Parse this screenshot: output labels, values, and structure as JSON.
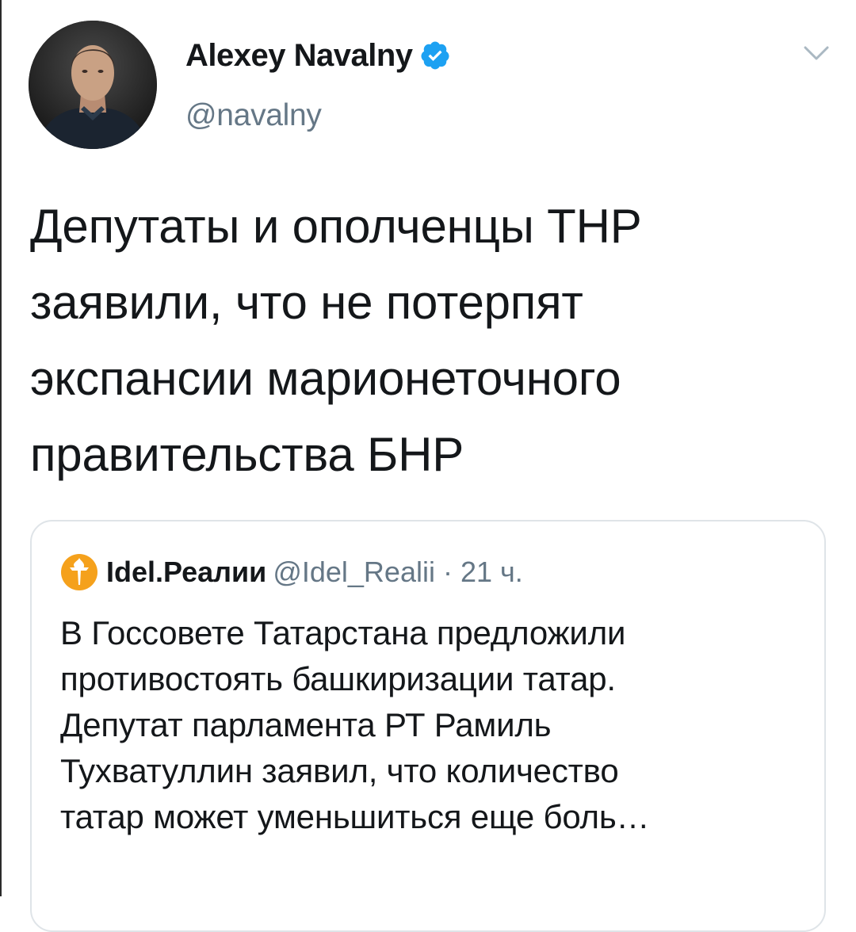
{
  "tweet": {
    "author_name": "Alexey Navalny",
    "handle": "@navalny",
    "verified": true,
    "avatar_icon": "profile-photo",
    "more_icon": "chevron-down-icon",
    "text": "Депутаты и ополченцы ТНР\nзаявили, что не потерпят\nэкспансии марионеточного\nправительства БНР"
  },
  "quoted_tweet": {
    "author_name": "Idel.Реалии",
    "handle": "@Idel_Realii",
    "separator": "·",
    "time": "21 ч.",
    "logo_icon": "torch-logo-icon",
    "text": "В Госсовете Татарстана предложили\nпротивостоять башкиризации татар.\nДепутат парламента РТ Рамиль\nТухватуллин заявил, что количество\nтатар может уменьшиться еще боль…"
  },
  "colors": {
    "verified_blue": "#1da1f2",
    "secondary_text": "#657786",
    "primary_text": "#14171a",
    "card_border": "#dfe4e8",
    "logo_orange": "#f5a11c"
  }
}
